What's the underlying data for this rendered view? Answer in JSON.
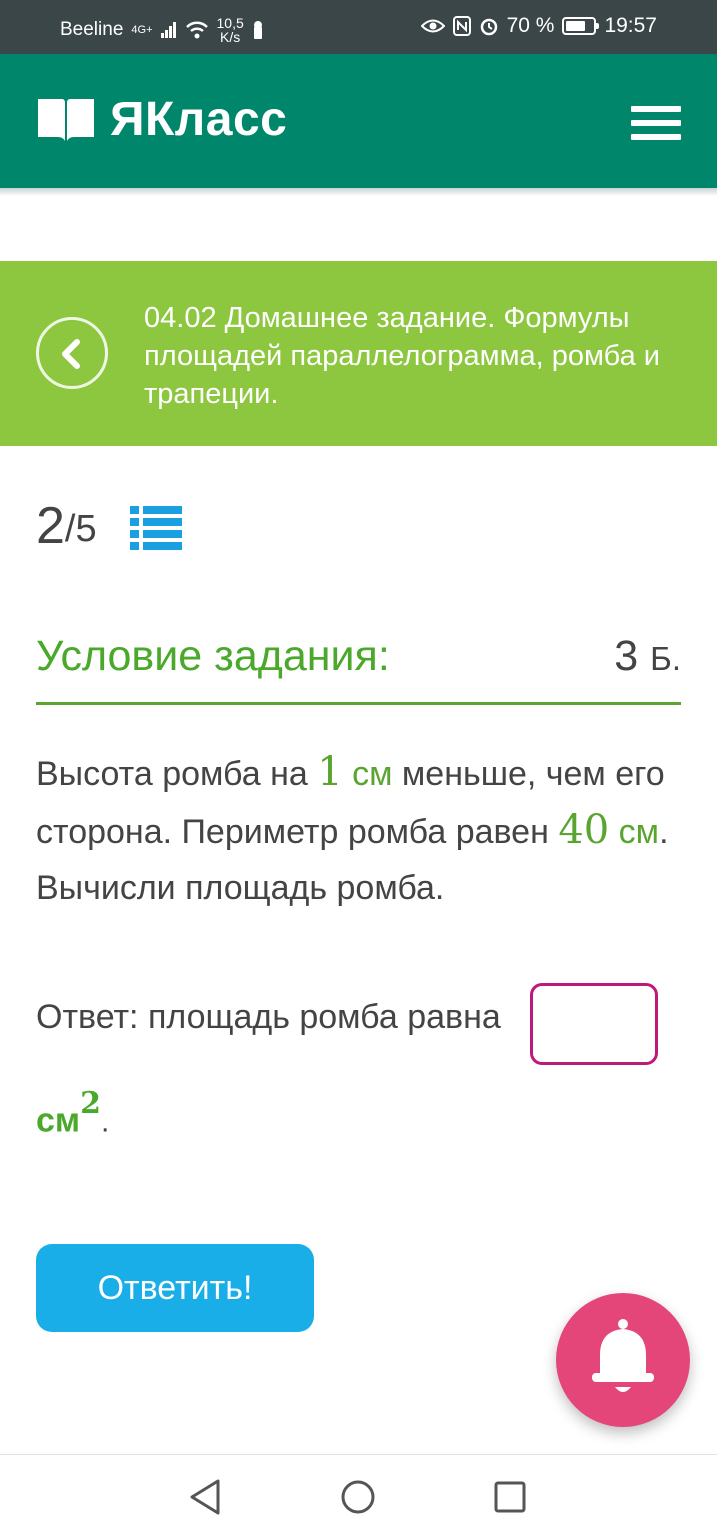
{
  "status_bar": {
    "carrier": "Beeline",
    "network": "4G+",
    "speed_value": "10,5",
    "speed_unit": "K/s",
    "battery": "70 %",
    "battery_level": 0.7,
    "time": "19:57"
  },
  "header": {
    "logo_text": "ЯКласс",
    "brand_color": "#00866a",
    "icons": [
      "book-logo-icon",
      "menu-icon"
    ]
  },
  "topic": {
    "title": "04.02 Домашнее задание. Формулы площадей параллелограмма, ромба и трапеции.",
    "banner_color": "#8dc63f"
  },
  "progress": {
    "current": "2",
    "total": "/5"
  },
  "task": {
    "heading": "Условие задания:",
    "points_value": "3",
    "points_unit": "Б.",
    "text": {
      "p1": "Высота ромба на ",
      "n1": "1",
      "u1": " см",
      "p2": " меньше, чем его сторона. Периметр ромба равен ",
      "n2": "40",
      "u2": " см",
      "p3": ". Вычисли площадь ромба."
    }
  },
  "answer": {
    "label": "Ответ: площадь ромба равна",
    "value": "",
    "unit": "см",
    "unit_power": "2",
    "end": "."
  },
  "submit_label": "Ответить!",
  "colors": {
    "accent_green": "#5aa532",
    "button_blue": "#1aaee8",
    "input_border": "#c0187a",
    "bell": "#e5467a"
  }
}
